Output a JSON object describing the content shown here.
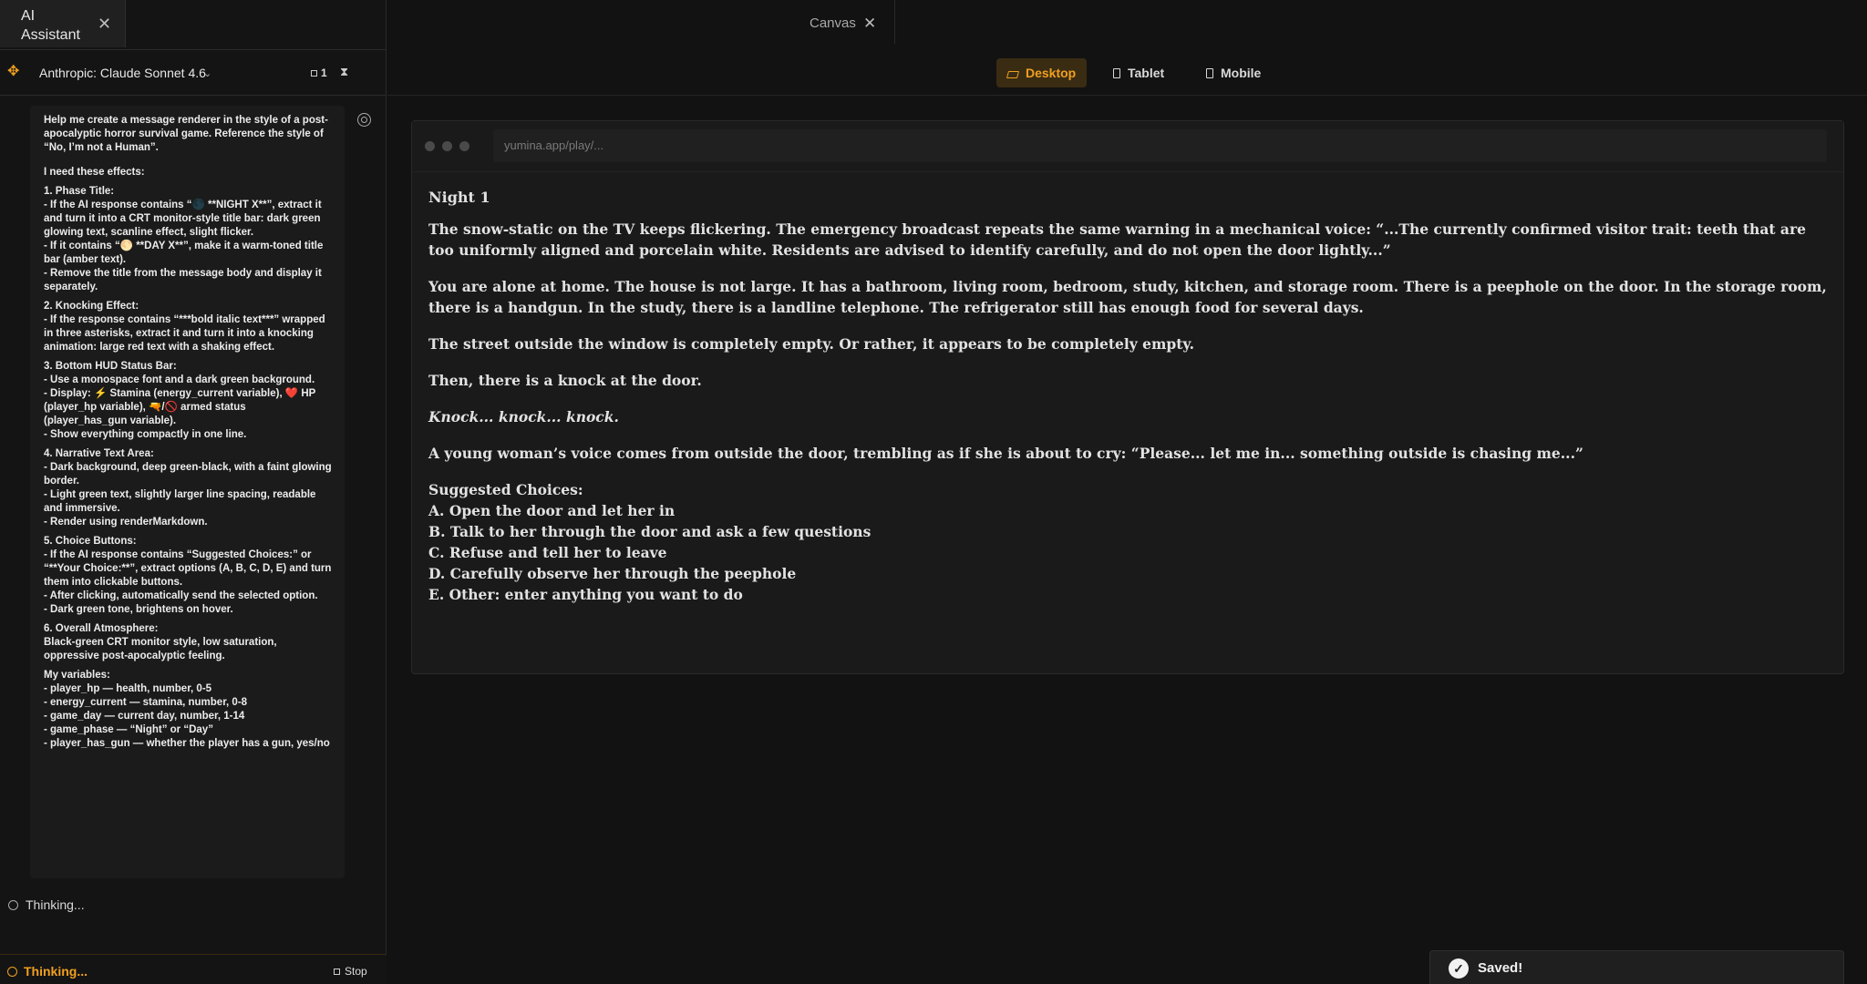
{
  "left_panel": {
    "tab_title": "AI Assistant",
    "model_name": "Anthropic: Claude Sonnet 4.6",
    "doc_count": "1",
    "message_lines": [
      "Help me create a message renderer in the style of a post-apocalyptic horror survival game. Reference the style of “No, I’m not a Human”.",
      "I need these effects:",
      "1. Phase Title:\n- If the AI response contains “🌑 **NIGHT X**”, extract it and turn it into a CRT monitor-style title bar: dark green glowing text, scanline effect, slight flicker.\n- If it contains “🌕 **DAY X**”, make it a warm-toned title bar (amber text).\n- Remove the title from the message body and display it separately.",
      "2. Knocking Effect:\n- If the response contains “***bold italic text***” wrapped in three asterisks, extract it and turn it into a knocking animation: large red text with a shaking effect.",
      "3. Bottom HUD Status Bar:\n- Use a monospace font and a dark green background.\n- Display: ⚡ Stamina (energy_current variable), ❤️ HP (player_hp variable), 🔫/🚫 armed status (player_has_gun variable).\n- Show everything compactly in one line.",
      "4. Narrative Text Area:\n- Dark background, deep green-black, with a faint glowing border.\n- Light green text, slightly larger line spacing, readable and immersive.\n- Render using renderMarkdown.",
      "5. Choice Buttons:\n- If the AI response contains “Suggested Choices:” or “**Your Choice:**”, extract options (A, B, C, D, E) and turn them into clickable buttons.\n- After clicking, automatically send the selected option.\n- Dark green tone, brightens on hover.",
      "6. Overall Atmosphere:\nBlack-green CRT monitor style, low saturation, oppressive post-apocalyptic feeling.",
      "My variables:\n- player_hp — health, number, 0-5\n- energy_current — stamina, number, 0-8\n- game_day — current day, number, 1-14\n- game_phase — “Night” or “Day”\n- player_has_gun — whether the player has a gun, yes/no"
    ],
    "thinking_status": "Thinking...",
    "bottom_thinking": "Thinking...",
    "stop_label": "Stop"
  },
  "canvas": {
    "tab_title": "Canvas",
    "devices": [
      "Desktop",
      "Tablet",
      "Mobile"
    ],
    "active_device": "Desktop",
    "url": "yumina.app/play/...",
    "story": {
      "title": "Night 1",
      "paragraphs": [
        "The snow-static on the TV keeps flickering. The emergency broadcast repeats the same warning in a mechanical voice: “...The currently confirmed visitor trait: teeth that are too uniformly aligned and porcelain white. Residents are advised to identify carefully, and do not open the door lightly...”",
        "You are alone at home. The house is not large. It has a bathroom, living room, bedroom, study, kitchen, and storage room. There is a peephole on the door. In the storage room, there is a handgun. In the study, there is a landline telephone. The refrigerator still has enough food for several days.",
        "The street outside the window is completely empty. Or rather, it appears to be completely empty.",
        "Then, there is a knock at the door."
      ],
      "knock": "Knock... knock... knock.",
      "voice": "A young woman’s voice comes from outside the door, trembling as if she is about to cry: “Please... let me in... something outside is chasing me...”",
      "choices_heading": "Suggested Choices:",
      "choices": [
        "A. Open the door and let her in",
        "B. Talk to her through the door and ask a few questions",
        "C. Refuse and tell her to leave",
        "D. Carefully observe her through the peephole",
        "E. Other: enter anything you want to do"
      ]
    }
  },
  "toast": {
    "text": "Saved!"
  },
  "colors": {
    "accent": "#f0a020",
    "background": "#121212"
  }
}
